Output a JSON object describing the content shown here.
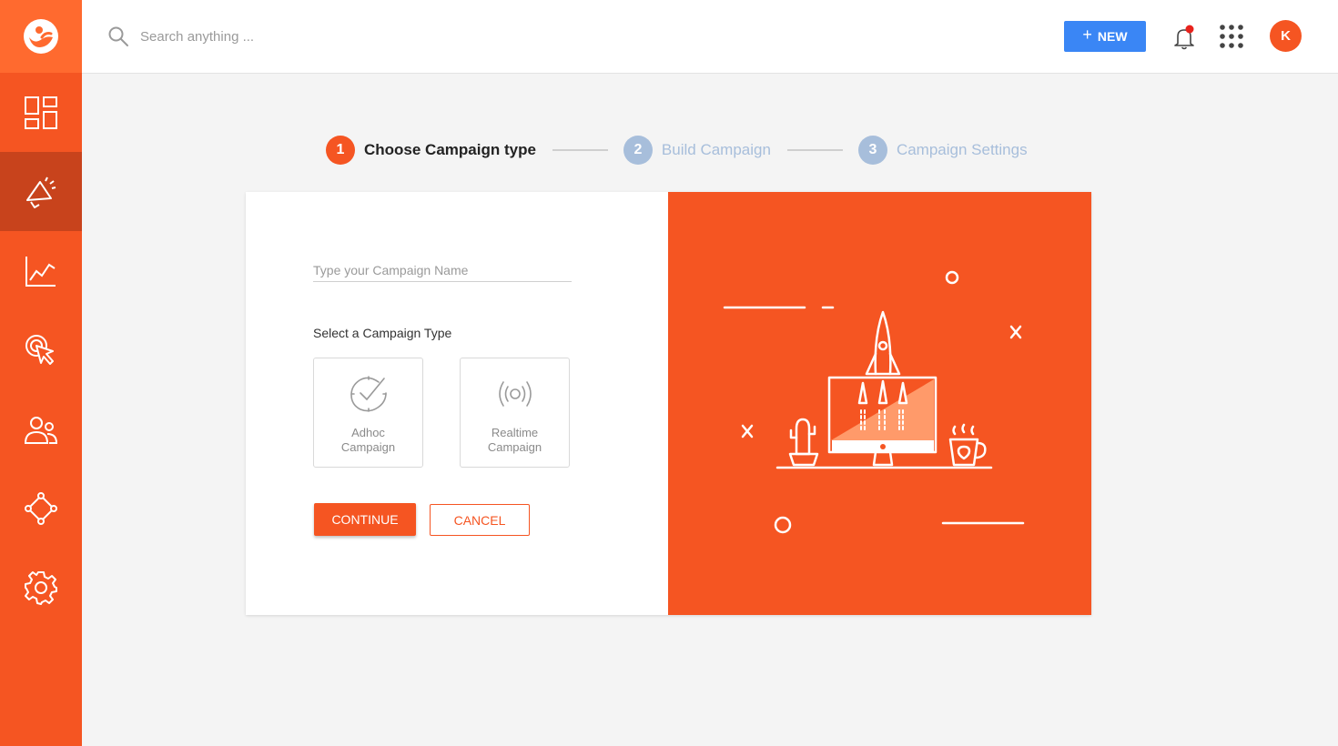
{
  "header": {
    "search_placeholder": "Search anything ...",
    "new_button_label": "NEW",
    "avatar_initial": "K"
  },
  "sidebar": {
    "items": [
      {
        "name": "dashboard",
        "icon": "dashboard-icon"
      },
      {
        "name": "campaigns",
        "icon": "megaphone-icon",
        "active": true
      },
      {
        "name": "analytics",
        "icon": "line-chart-icon"
      },
      {
        "name": "targeting",
        "icon": "cursor-click-icon"
      },
      {
        "name": "users",
        "icon": "users-icon"
      },
      {
        "name": "journeys",
        "icon": "journey-diamond-icon"
      },
      {
        "name": "settings",
        "icon": "gear-icon"
      }
    ]
  },
  "stepper": {
    "steps": [
      {
        "num": "1",
        "label": "Choose Campaign type",
        "state": "active"
      },
      {
        "num": "2",
        "label": "Build Campaign",
        "state": "inactive"
      },
      {
        "num": "3",
        "label": "Campaign Settings",
        "state": "inactive"
      }
    ]
  },
  "form": {
    "name_placeholder": "Type your Campaign Name",
    "type_label": "Select a Campaign Type",
    "types": [
      {
        "line1": "Adhoc",
        "line2": "Campaign",
        "icon": "clock-check-icon"
      },
      {
        "line1": "Realtime",
        "line2": "Campaign",
        "icon": "broadcast-icon"
      }
    ],
    "continue_label": "CONTINUE",
    "cancel_label": "CANCEL"
  },
  "colors": {
    "brand": "#f55522",
    "brand_dark": "#c8431c",
    "primary_blue": "#3a86f5",
    "step_inactive": "#a7bedb"
  }
}
